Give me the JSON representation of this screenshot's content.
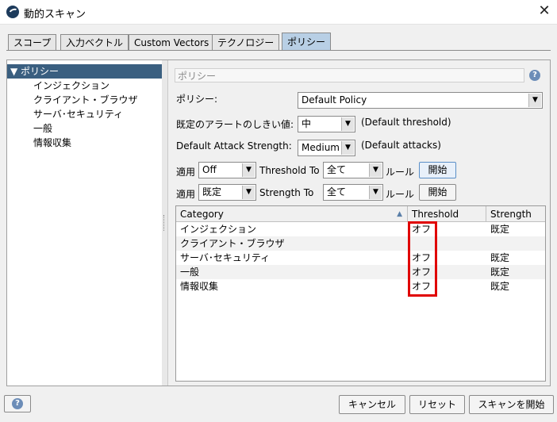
{
  "window": {
    "title": "動的スキャン",
    "close_glyph": "✕"
  },
  "tabs": [
    {
      "label": "スコープ"
    },
    {
      "label": "入力ベクトル"
    },
    {
      "label": "Custom Vectors"
    },
    {
      "label": "テクノロジー"
    },
    {
      "label": "ポリシー",
      "active": true
    }
  ],
  "tree": {
    "root": "▼ ポリシー",
    "items": [
      "インジェクション",
      "クライアント・ブラウザ",
      "サーバ･セキュリティ",
      "一般",
      "情報収集"
    ]
  },
  "panel": {
    "title": "ポリシー",
    "policy_label": "ポリシー:",
    "policy_value": "Default Policy",
    "threshold_label": "既定のアラートのしきい値:",
    "threshold_value": "中",
    "threshold_note": "(Default threshold)",
    "strength_label": "Default Attack Strength:",
    "strength_value": "Medium",
    "strength_note": "(Default attacks)",
    "apply1": {
      "label": "適用",
      "value": "Off",
      "to_label": "Threshold To",
      "target": "全て",
      "rule_label": "ルール",
      "button": "開始"
    },
    "apply2": {
      "label": "適用",
      "value": "既定",
      "to_label": "Strength To",
      "target": "全て",
      "rule_label": "ルール",
      "button": "開始"
    }
  },
  "table": {
    "columns": [
      "Category",
      "Threshold",
      "Strength"
    ],
    "sort_glyph": "▲",
    "rows": [
      [
        "インジェクション",
        "オフ",
        "既定"
      ],
      [
        "クライアント・ブラウザ",
        "",
        ""
      ],
      [
        "サーバ･セキュリティ",
        "オフ",
        "既定"
      ],
      [
        "一般",
        "オフ",
        "既定"
      ],
      [
        "情報収集",
        "オフ",
        "既定"
      ]
    ]
  },
  "footer": {
    "cancel": "キャンセル",
    "reset": "リセット",
    "start": "スキャンを開始",
    "help_glyph": "?"
  },
  "colors": {
    "highlight": "#e00000",
    "tree_selected": "#3a5f80",
    "active_tab": "#b8cfe5"
  }
}
